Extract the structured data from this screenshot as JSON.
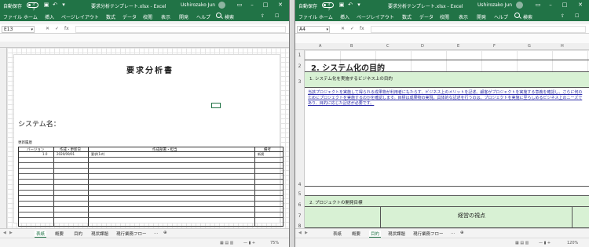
{
  "left_window": {
    "autosave_label": "自動保存",
    "autosave_state": "オフ",
    "title": "要求分析テンプレート.xlsx - Excel",
    "user": "Ushirozako Jun",
    "ribbon_tabs": [
      "ファイル",
      "ホーム",
      "挿入",
      "ページレイアウト",
      "数式",
      "データ",
      "校閲",
      "表示",
      "開発",
      "ヘルプ",
      "検索"
    ],
    "name_box": "E13",
    "doc_title": "要求分析書",
    "system_name_label": "システム名：",
    "revision_heading": "更新履歴",
    "revision_columns": [
      "バージョン",
      "作成・更新日",
      "作成部署・担当",
      "備考"
    ],
    "revision_rows": [
      [
        "1.0",
        "2020/09/01",
        "要求(1st)",
        "新規"
      ]
    ],
    "sheet_tabs": [
      "表紙",
      "概要",
      "目的",
      "現状課題",
      "現行業務フロー"
    ],
    "zoom": "75%"
  },
  "right_window": {
    "autosave_label": "自動保存",
    "autosave_state": "オフ",
    "title": "要求分析テンプレート.xlsx - Excel",
    "user": "Ushirozako Jun",
    "ribbon_tabs": [
      "ファイル",
      "ホーム",
      "挿入",
      "ページレイアウト",
      "数式",
      "データ",
      "校閲",
      "表示",
      "開発",
      "ヘルプ",
      "検索"
    ],
    "name_box": "A4",
    "columns": [
      "A",
      "B",
      "C",
      "D",
      "E",
      "F",
      "G",
      "H"
    ],
    "rows": [
      "1",
      "2",
      "3",
      "4",
      "5",
      "6",
      "7",
      "8"
    ],
    "section_title": "2. システム化の目的",
    "subheading1": "1. システム化を実施するビジネス上の目的",
    "body_text": "当該プロジェクトを実施して得られる成果物が利用者にもたらす、ビジネス上のメリットを記述。顧客がプロジェクトを実施する意義を確認し、さらに何のためにプロジェクトを実施するのかを確認します。目標は成果物の実現。具体的な記述を行うのは、プロジェクトを実施に至らしめるビジネス上のニーズであり、目的に応じた記述が必要です。",
    "subheading2": "2. プロジェクトの開発目標",
    "viewpoint_header": "経営の視点",
    "sheet_tabs": [
      "表紙",
      "概要",
      "目的",
      "現状課題",
      "現行業務フロー"
    ],
    "zoom": "120%"
  },
  "colors": {
    "excel_green": "#217346",
    "light_green": "#d8f1d4",
    "link_blue": "#2c2ca8"
  }
}
